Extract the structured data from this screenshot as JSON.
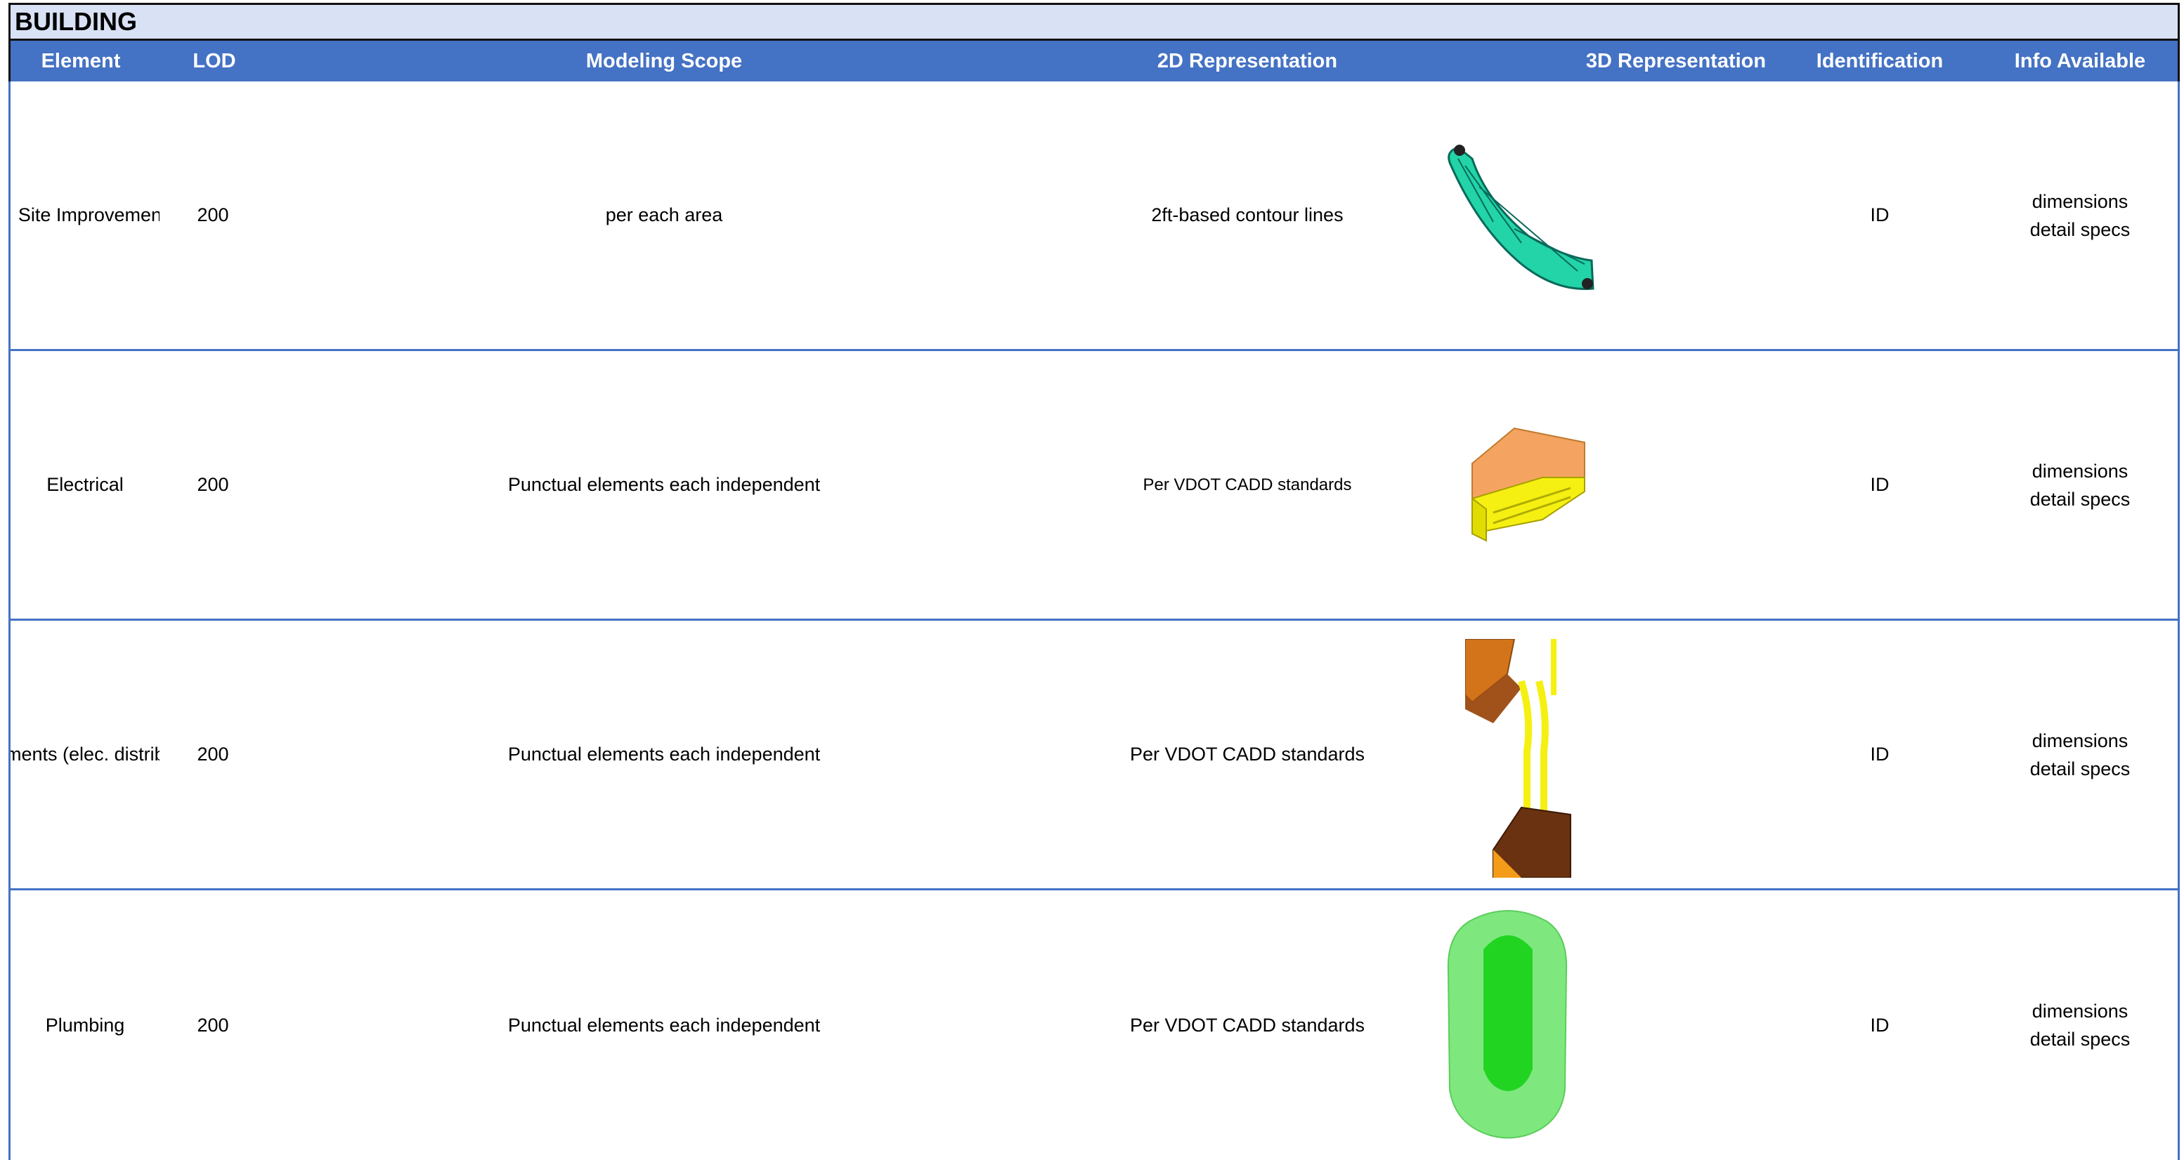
{
  "sheet_title": "BUILDING",
  "columns": [
    "Element",
    "LOD",
    "Modeling Scope",
    "2D Representation",
    "3D Representation",
    "Identification",
    "Info Available"
  ],
  "rows": [
    {
      "element": "Site Improvements",
      "lod": "200",
      "scope": "per each area",
      "rep2d": "2ft-based contour lines",
      "rep3d": "site-improvement-model-icon",
      "identification": "ID",
      "info": [
        "dimensions",
        "detail specs"
      ]
    },
    {
      "element": "Electrical",
      "lod": "200",
      "scope": "Punctual elements each independent",
      "rep2d": "Per VDOT CADD standards",
      "rep3d": "electrical-model-icon",
      "identification": "ID",
      "info": [
        "dimensions",
        "detail specs"
      ]
    },
    {
      "element": "Elements (elec. distribution)",
      "lod": "200",
      "scope": "Punctual elements each independent",
      "rep2d": "Per VDOT CADD standards",
      "rep3d": "electrical-distribution-model-icon",
      "identification": "ID",
      "info": [
        "dimensions",
        "detail specs"
      ]
    },
    {
      "element": "Plumbing",
      "lod": "200",
      "scope": "Punctual elements each independent",
      "rep2d": "Per VDOT CADD standards",
      "rep3d": "plumbing-model-icon",
      "identification": "ID",
      "info": [
        "dimensions",
        "detail specs"
      ]
    }
  ],
  "colors": {
    "header_bg": "#4472c4",
    "title_bg": "#d9e1f5",
    "grid_line": "#4472c4"
  }
}
